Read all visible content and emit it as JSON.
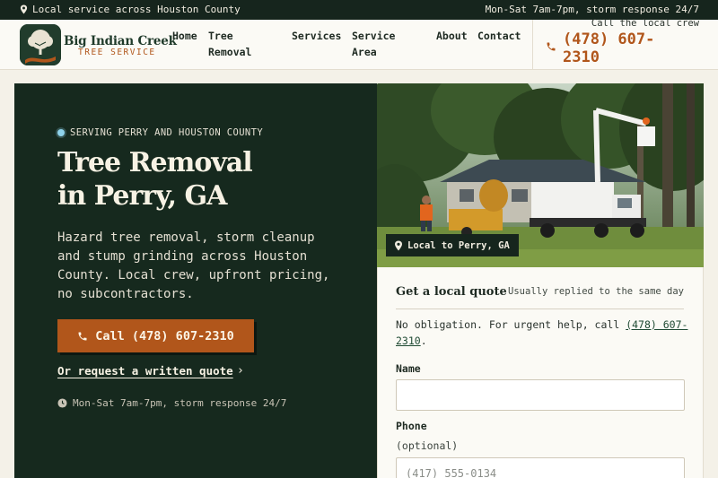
{
  "topbar": {
    "location": "Local service across Houston County",
    "hours": "Mon-Sat 7am-7pm, storm response 24/7"
  },
  "brand": {
    "name": "Big Indian Creek",
    "subtitle": "TREE SERVICE"
  },
  "nav": {
    "items": [
      "Home",
      "Tree Removal",
      "Services",
      "Service Area",
      "About",
      "Contact"
    ]
  },
  "header_call": {
    "label": "Call the local crew",
    "phone": "(478) 607-2310"
  },
  "hero": {
    "eyebrow": "SERVING PERRY AND HOUSTON COUNTY",
    "title_line1": "Tree Removal",
    "title_line2": "in Perry, GA",
    "lead": "Hazard tree removal, storm cleanup and stump grinding across Houston County. Local crew, upfront pricing, no subcontractors.",
    "cta_label": "Call (478) 607-2310",
    "alt_link": "Or request a written quote",
    "hours": "Mon-Sat 7am-7pm, storm response 24/7"
  },
  "photo": {
    "tag": "Local to Perry, GA"
  },
  "quote": {
    "title": "Get a local quote",
    "reply_note": "Usually replied to the same day",
    "note_prefix": "No obligation. For urgent help, call ",
    "note_phone": "(478) 607-2310",
    "note_suffix": ".",
    "name_label": "Name",
    "name_value": "",
    "phone_label": "Phone",
    "phone_optional": "(optional)",
    "phone_placeholder": "(417) 555-0134"
  },
  "colors": {
    "brand_green": "#16291e",
    "accent_orange": "#b1561b",
    "cream": "#fbfaf5"
  }
}
